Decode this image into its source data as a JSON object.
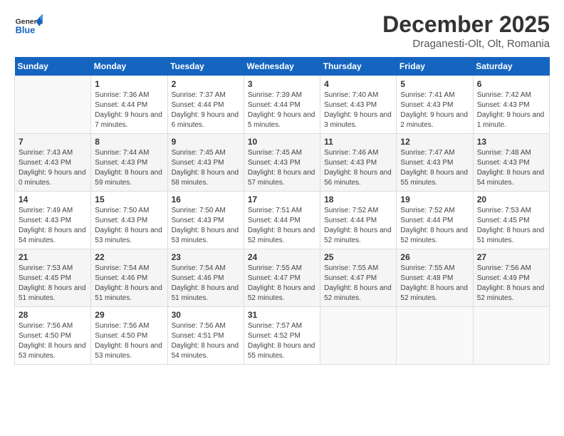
{
  "logo": {
    "line1": "General",
    "line2": "Blue"
  },
  "header": {
    "month": "December 2025",
    "location": "Draganesti-Olt, Olt, Romania"
  },
  "weekdays": [
    "Sunday",
    "Monday",
    "Tuesday",
    "Wednesday",
    "Thursday",
    "Friday",
    "Saturday"
  ],
  "weeks": [
    [
      {
        "day": "",
        "empty": true
      },
      {
        "day": "1",
        "sunrise": "7:36 AM",
        "sunset": "4:44 PM",
        "daylight": "9 hours and 7 minutes."
      },
      {
        "day": "2",
        "sunrise": "7:37 AM",
        "sunset": "4:44 PM",
        "daylight": "9 hours and 6 minutes."
      },
      {
        "day": "3",
        "sunrise": "7:39 AM",
        "sunset": "4:44 PM",
        "daylight": "9 hours and 5 minutes."
      },
      {
        "day": "4",
        "sunrise": "7:40 AM",
        "sunset": "4:43 PM",
        "daylight": "9 hours and 3 minutes."
      },
      {
        "day": "5",
        "sunrise": "7:41 AM",
        "sunset": "4:43 PM",
        "daylight": "9 hours and 2 minutes."
      },
      {
        "day": "6",
        "sunrise": "7:42 AM",
        "sunset": "4:43 PM",
        "daylight": "9 hours and 1 minute."
      }
    ],
    [
      {
        "day": "7",
        "sunrise": "7:43 AM",
        "sunset": "4:43 PM",
        "daylight": "9 hours and 0 minutes."
      },
      {
        "day": "8",
        "sunrise": "7:44 AM",
        "sunset": "4:43 PM",
        "daylight": "8 hours and 59 minutes."
      },
      {
        "day": "9",
        "sunrise": "7:45 AM",
        "sunset": "4:43 PM",
        "daylight": "8 hours and 58 minutes."
      },
      {
        "day": "10",
        "sunrise": "7:45 AM",
        "sunset": "4:43 PM",
        "daylight": "8 hours and 57 minutes."
      },
      {
        "day": "11",
        "sunrise": "7:46 AM",
        "sunset": "4:43 PM",
        "daylight": "8 hours and 56 minutes."
      },
      {
        "day": "12",
        "sunrise": "7:47 AM",
        "sunset": "4:43 PM",
        "daylight": "8 hours and 55 minutes."
      },
      {
        "day": "13",
        "sunrise": "7:48 AM",
        "sunset": "4:43 PM",
        "daylight": "8 hours and 54 minutes."
      }
    ],
    [
      {
        "day": "14",
        "sunrise": "7:49 AM",
        "sunset": "4:43 PM",
        "daylight": "8 hours and 54 minutes."
      },
      {
        "day": "15",
        "sunrise": "7:50 AM",
        "sunset": "4:43 PM",
        "daylight": "8 hours and 53 minutes."
      },
      {
        "day": "16",
        "sunrise": "7:50 AM",
        "sunset": "4:43 PM",
        "daylight": "8 hours and 53 minutes."
      },
      {
        "day": "17",
        "sunrise": "7:51 AM",
        "sunset": "4:44 PM",
        "daylight": "8 hours and 52 minutes."
      },
      {
        "day": "18",
        "sunrise": "7:52 AM",
        "sunset": "4:44 PM",
        "daylight": "8 hours and 52 minutes."
      },
      {
        "day": "19",
        "sunrise": "7:52 AM",
        "sunset": "4:44 PM",
        "daylight": "8 hours and 52 minutes."
      },
      {
        "day": "20",
        "sunrise": "7:53 AM",
        "sunset": "4:45 PM",
        "daylight": "8 hours and 51 minutes."
      }
    ],
    [
      {
        "day": "21",
        "sunrise": "7:53 AM",
        "sunset": "4:45 PM",
        "daylight": "8 hours and 51 minutes."
      },
      {
        "day": "22",
        "sunrise": "7:54 AM",
        "sunset": "4:46 PM",
        "daylight": "8 hours and 51 minutes."
      },
      {
        "day": "23",
        "sunrise": "7:54 AM",
        "sunset": "4:46 PM",
        "daylight": "8 hours and 51 minutes."
      },
      {
        "day": "24",
        "sunrise": "7:55 AM",
        "sunset": "4:47 PM",
        "daylight": "8 hours and 52 minutes."
      },
      {
        "day": "25",
        "sunrise": "7:55 AM",
        "sunset": "4:47 PM",
        "daylight": "8 hours and 52 minutes."
      },
      {
        "day": "26",
        "sunrise": "7:55 AM",
        "sunset": "4:48 PM",
        "daylight": "8 hours and 52 minutes."
      },
      {
        "day": "27",
        "sunrise": "7:56 AM",
        "sunset": "4:49 PM",
        "daylight": "8 hours and 52 minutes."
      }
    ],
    [
      {
        "day": "28",
        "sunrise": "7:56 AM",
        "sunset": "4:50 PM",
        "daylight": "8 hours and 53 minutes."
      },
      {
        "day": "29",
        "sunrise": "7:56 AM",
        "sunset": "4:50 PM",
        "daylight": "8 hours and 53 minutes."
      },
      {
        "day": "30",
        "sunrise": "7:56 AM",
        "sunset": "4:51 PM",
        "daylight": "8 hours and 54 minutes."
      },
      {
        "day": "31",
        "sunrise": "7:57 AM",
        "sunset": "4:52 PM",
        "daylight": "8 hours and 55 minutes."
      },
      {
        "day": "",
        "empty": true
      },
      {
        "day": "",
        "empty": true
      },
      {
        "day": "",
        "empty": true
      }
    ]
  ],
  "labels": {
    "sunrise_prefix": "Sunrise: ",
    "sunset_prefix": "Sunset: ",
    "daylight_prefix": "Daylight: "
  }
}
